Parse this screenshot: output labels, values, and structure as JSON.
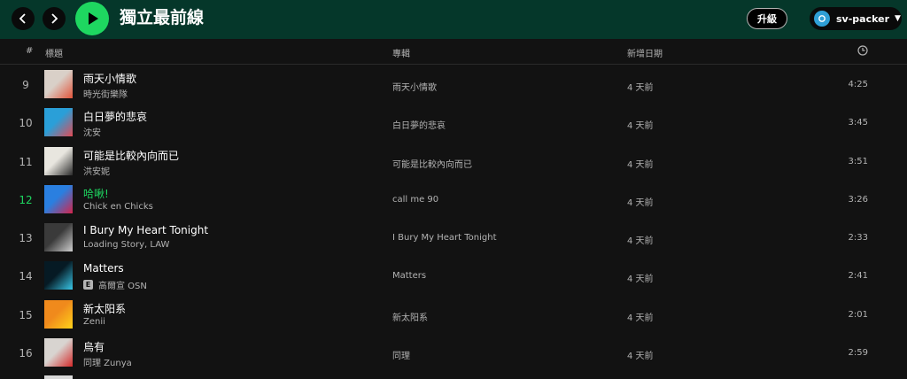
{
  "topbar": {
    "title": "獨立最前線",
    "upgrade_label": "升級",
    "user_name": "sv-packer"
  },
  "columns": {
    "index": "#",
    "title": "標題",
    "album": "專輯",
    "added": "新增日期",
    "duration_icon": "clock-icon"
  },
  "tracks": [
    {
      "index": "9",
      "title": "雨天小情歌",
      "artist": "時光街樂隊",
      "album": "雨天小情歌",
      "added": "4 天前",
      "duration": "4:25",
      "explicit": false,
      "active": false,
      "cover_colors": [
        "#d9d0c8",
        "#e2543a"
      ]
    },
    {
      "index": "10",
      "title": "白日夢的悲哀",
      "artist": "沈安",
      "album": "白日夢的悲哀",
      "added": "4 天前",
      "duration": "3:45",
      "explicit": false,
      "active": false,
      "cover_colors": [
        "#2a9fd8",
        "#e04b55"
      ]
    },
    {
      "index": "11",
      "title": "可能是比較內向而已",
      "artist": "洪安妮",
      "album": "可能是比較內向而已",
      "added": "4 天前",
      "duration": "3:51",
      "explicit": false,
      "active": false,
      "cover_colors": [
        "#e8e6df",
        "#2a2a2a"
      ]
    },
    {
      "index": "12",
      "title": "哈啾!",
      "artist": "Chick en Chicks",
      "album": "call me 90",
      "added": "4 天前",
      "duration": "3:26",
      "explicit": false,
      "active": true,
      "cover_colors": [
        "#2a7fe0",
        "#d3244b"
      ]
    },
    {
      "index": "13",
      "title": "I Bury My Heart Tonight",
      "artist": "Loading Story, LAW",
      "album": "I Bury My Heart Tonight",
      "added": "4 天前",
      "duration": "2:33",
      "explicit": false,
      "active": false,
      "cover_colors": [
        "#3a3a3a",
        "#cfcfcf"
      ]
    },
    {
      "index": "14",
      "title": "Matters",
      "artist": "高爾宣 OSN",
      "album": "Matters",
      "added": "4 天前",
      "duration": "2:41",
      "explicit": true,
      "active": false,
      "cover_colors": [
        "#061a24",
        "#39c7e8"
      ]
    },
    {
      "index": "15",
      "title": "新太阳系",
      "artist": "Zenii",
      "album": "新太阳系",
      "added": "4 天前",
      "duration": "2:01",
      "explicit": false,
      "active": false,
      "cover_colors": [
        "#f08a1c",
        "#ffd21a"
      ]
    },
    {
      "index": "16",
      "title": "烏有",
      "artist": "同理 Zunya",
      "album": "同理",
      "added": "4 天前",
      "duration": "2:59",
      "explicit": false,
      "active": false,
      "cover_colors": [
        "#d8d4d0",
        "#d42a2a"
      ]
    }
  ]
}
